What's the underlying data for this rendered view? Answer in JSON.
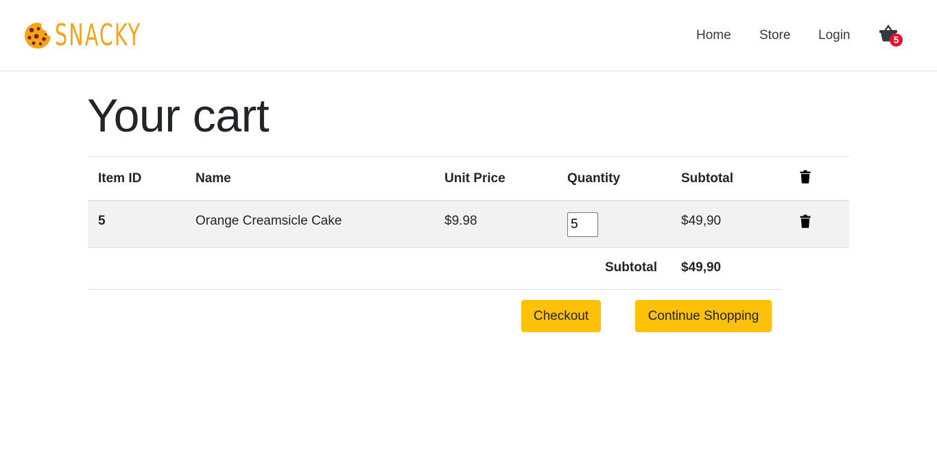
{
  "brand": {
    "name": "SNACKY",
    "logo_icon": "cookie-icon",
    "color": "#f2a51a"
  },
  "nav": {
    "items": [
      {
        "label": "Home"
      },
      {
        "label": "Store"
      },
      {
        "label": "Login"
      }
    ],
    "cart": {
      "icon": "shopping-basket-icon",
      "count": "5",
      "badge_color": "#e8112d"
    }
  },
  "page": {
    "title": "Your cart"
  },
  "table": {
    "headers": {
      "item_id": "Item ID",
      "name": "Name",
      "unit_price": "Unit Price",
      "quantity": "Quantity",
      "subtotal": "Subtotal",
      "delete_icon": "trash-icon"
    },
    "rows": [
      {
        "item_id": "5",
        "name": "Orange Creamsicle Cake",
        "unit_price": "$9.98",
        "quantity": "5",
        "subtotal": "$49,90",
        "delete_icon": "trash-icon"
      }
    ],
    "total": {
      "label": "Subtotal",
      "value": "$49,90"
    }
  },
  "actions": {
    "checkout_label": "Checkout",
    "continue_label": "Continue Shopping",
    "button_color": "#ffc107"
  }
}
